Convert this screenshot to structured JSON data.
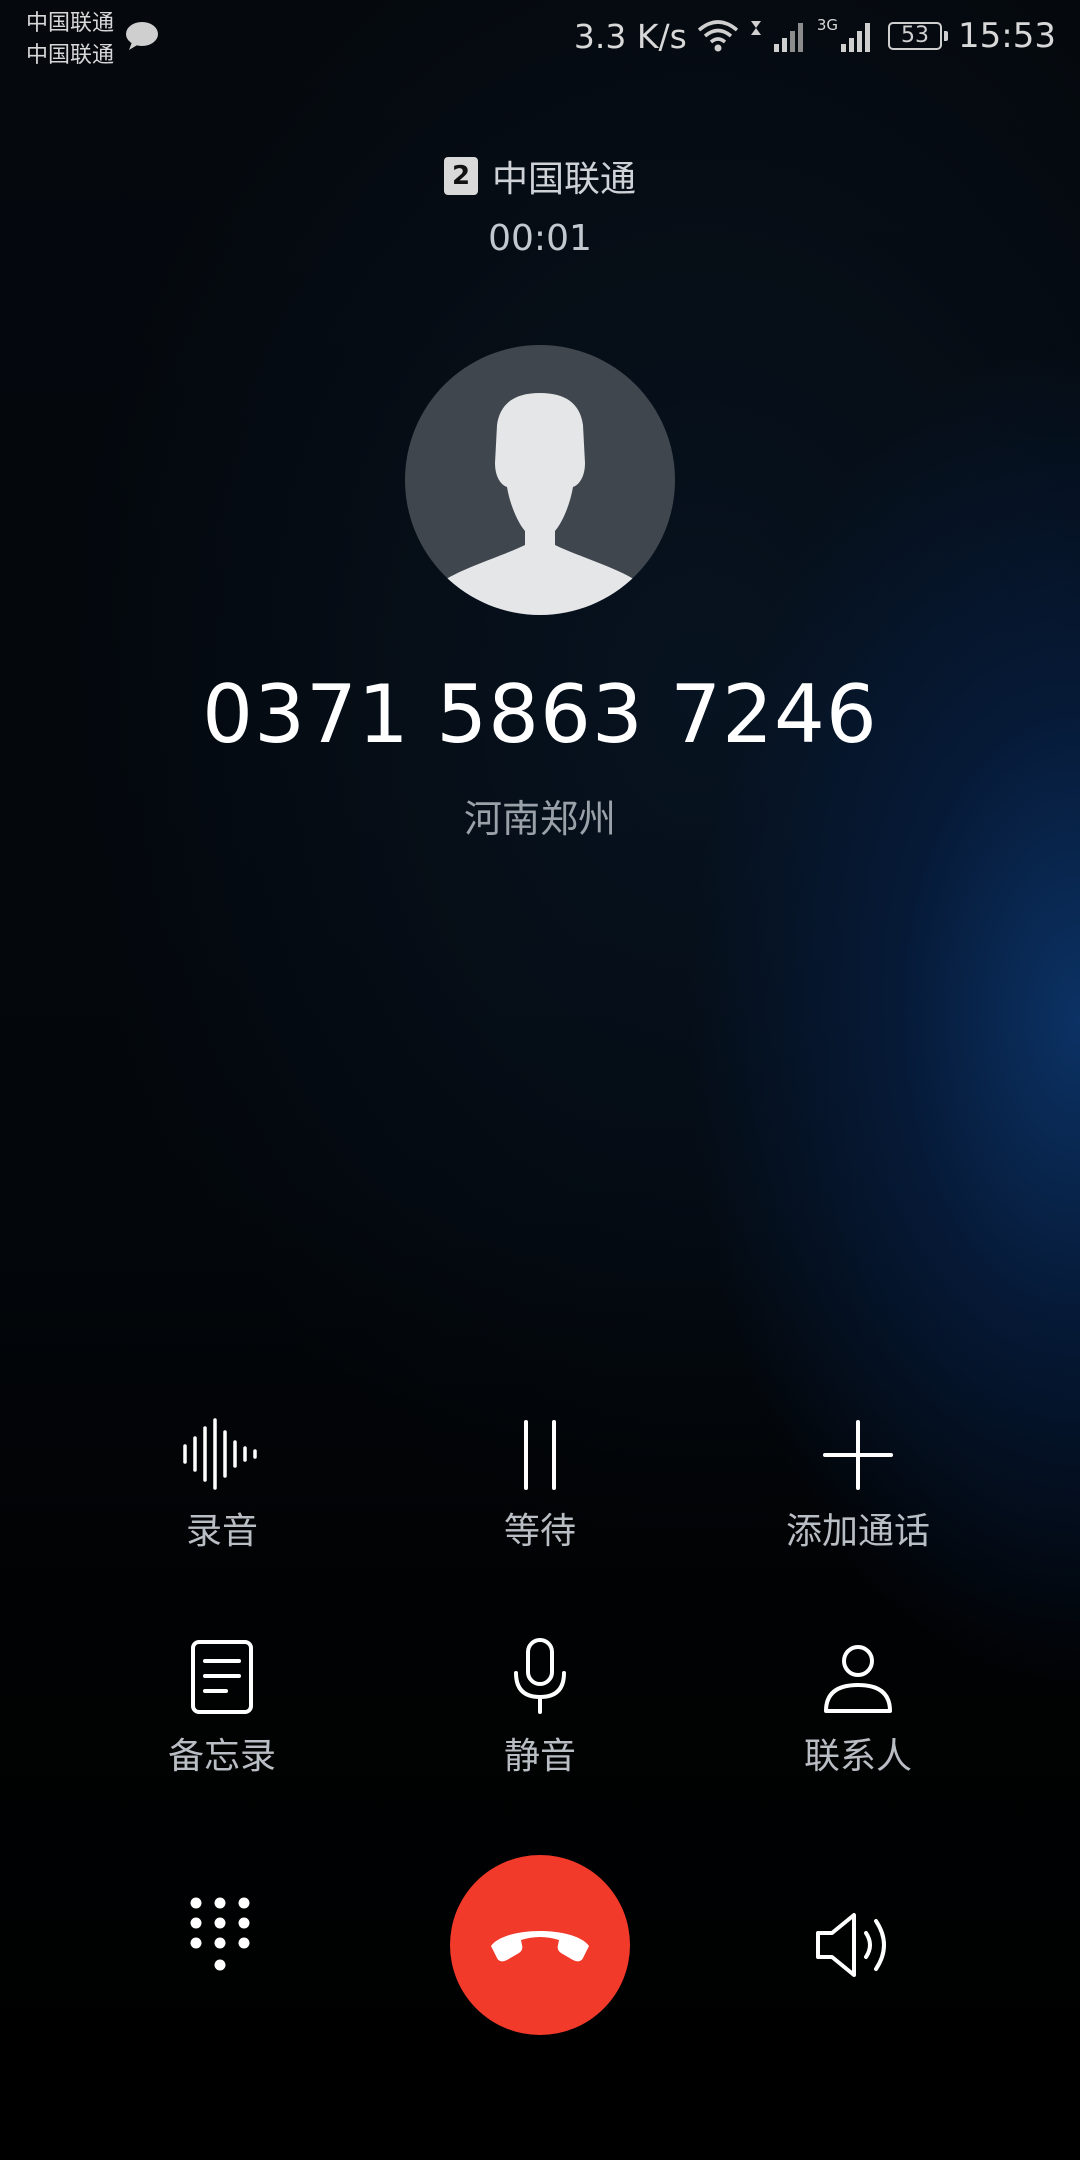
{
  "status_bar": {
    "carrier_1": "中国联通",
    "carrier_2": "中国联通",
    "net_speed": "3.3 K/s",
    "network_type": "3G",
    "battery": "53",
    "time": "15:53"
  },
  "call": {
    "sim_slot": "2",
    "carrier": "中国联通",
    "timer": "00:01",
    "number": "0371 5863 7246",
    "location": "河南郑州"
  },
  "actions": {
    "record": "录音",
    "hold": "等待",
    "add_call": "添加通话",
    "memo": "备忘录",
    "mute": "静音",
    "contacts": "联系人"
  },
  "colors": {
    "end_call": "#f23a2b",
    "accent_blue": "#0c3469"
  }
}
